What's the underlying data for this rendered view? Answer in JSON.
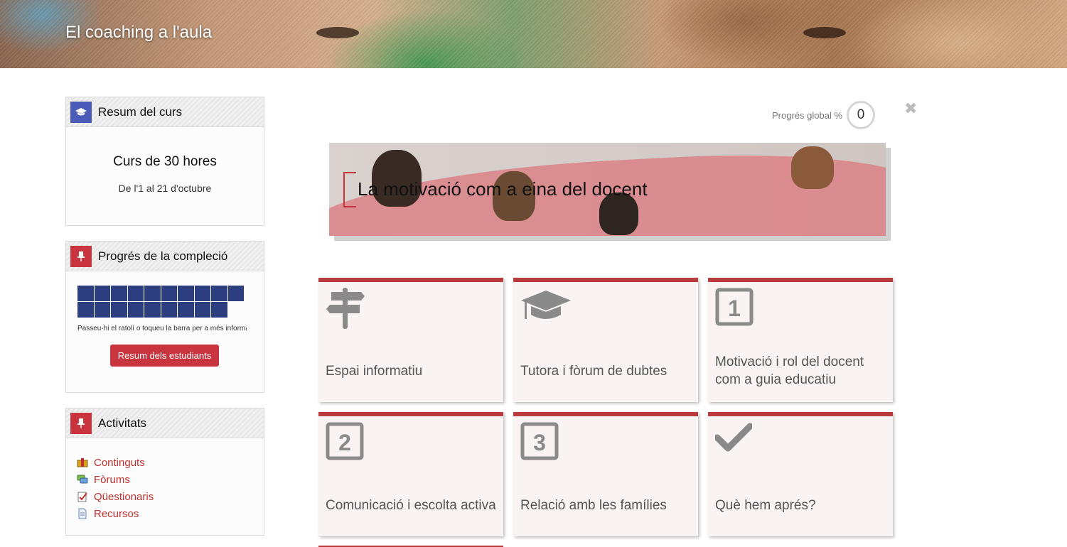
{
  "header": {
    "course_title": "El coaching a l'aula"
  },
  "course_summary": {
    "title": "Resum del curs",
    "icon": "graduation-cap-icon",
    "hours": "Curs de 30 hores",
    "dates": "De l'1 al 21 d'octubre"
  },
  "completion_progress": {
    "title": "Progrés de la compleció",
    "icon": "pin-icon",
    "total_activities": 19,
    "hint": "Passeu-hi el ratolí o toqueu la barra per a més informació",
    "button_label": "Resum dels estudiants"
  },
  "activities": {
    "title": "Activitats",
    "icon": "pin-icon",
    "items": [
      {
        "label": "Continguts",
        "icon": "content-box-icon"
      },
      {
        "label": "Fòrums",
        "icon": "forum-icon"
      },
      {
        "label": "Qüestionaris",
        "icon": "quiz-icon"
      },
      {
        "label": "Recursos",
        "icon": "resource-icon"
      }
    ]
  },
  "global_progress": {
    "label": "Progrés global %",
    "value": "0"
  },
  "section_banner": {
    "title": "La motivació com a eina del docent"
  },
  "tiles": [
    {
      "label": "Espai informatiu",
      "icon": "signpost-icon"
    },
    {
      "label": "Tutora i fòrum de dubtes",
      "icon": "graduation-cap-icon"
    },
    {
      "label": "Motivació i rol del docent com a guia educatiu",
      "icon": "number-1-icon"
    },
    {
      "label": "Comunicació i escolta activa",
      "icon": "number-2-icon"
    },
    {
      "label": "Relació amb les famílies",
      "icon": "number-3-icon"
    },
    {
      "label": "Què hem aprés?",
      "icon": "checkmark-icon"
    }
  ],
  "colors": {
    "accent_red": "#c9343f",
    "tile_border": "#b93b3b",
    "progress_blue": "#2c3e80",
    "summary_icon_blue": "#4a5bb8"
  }
}
